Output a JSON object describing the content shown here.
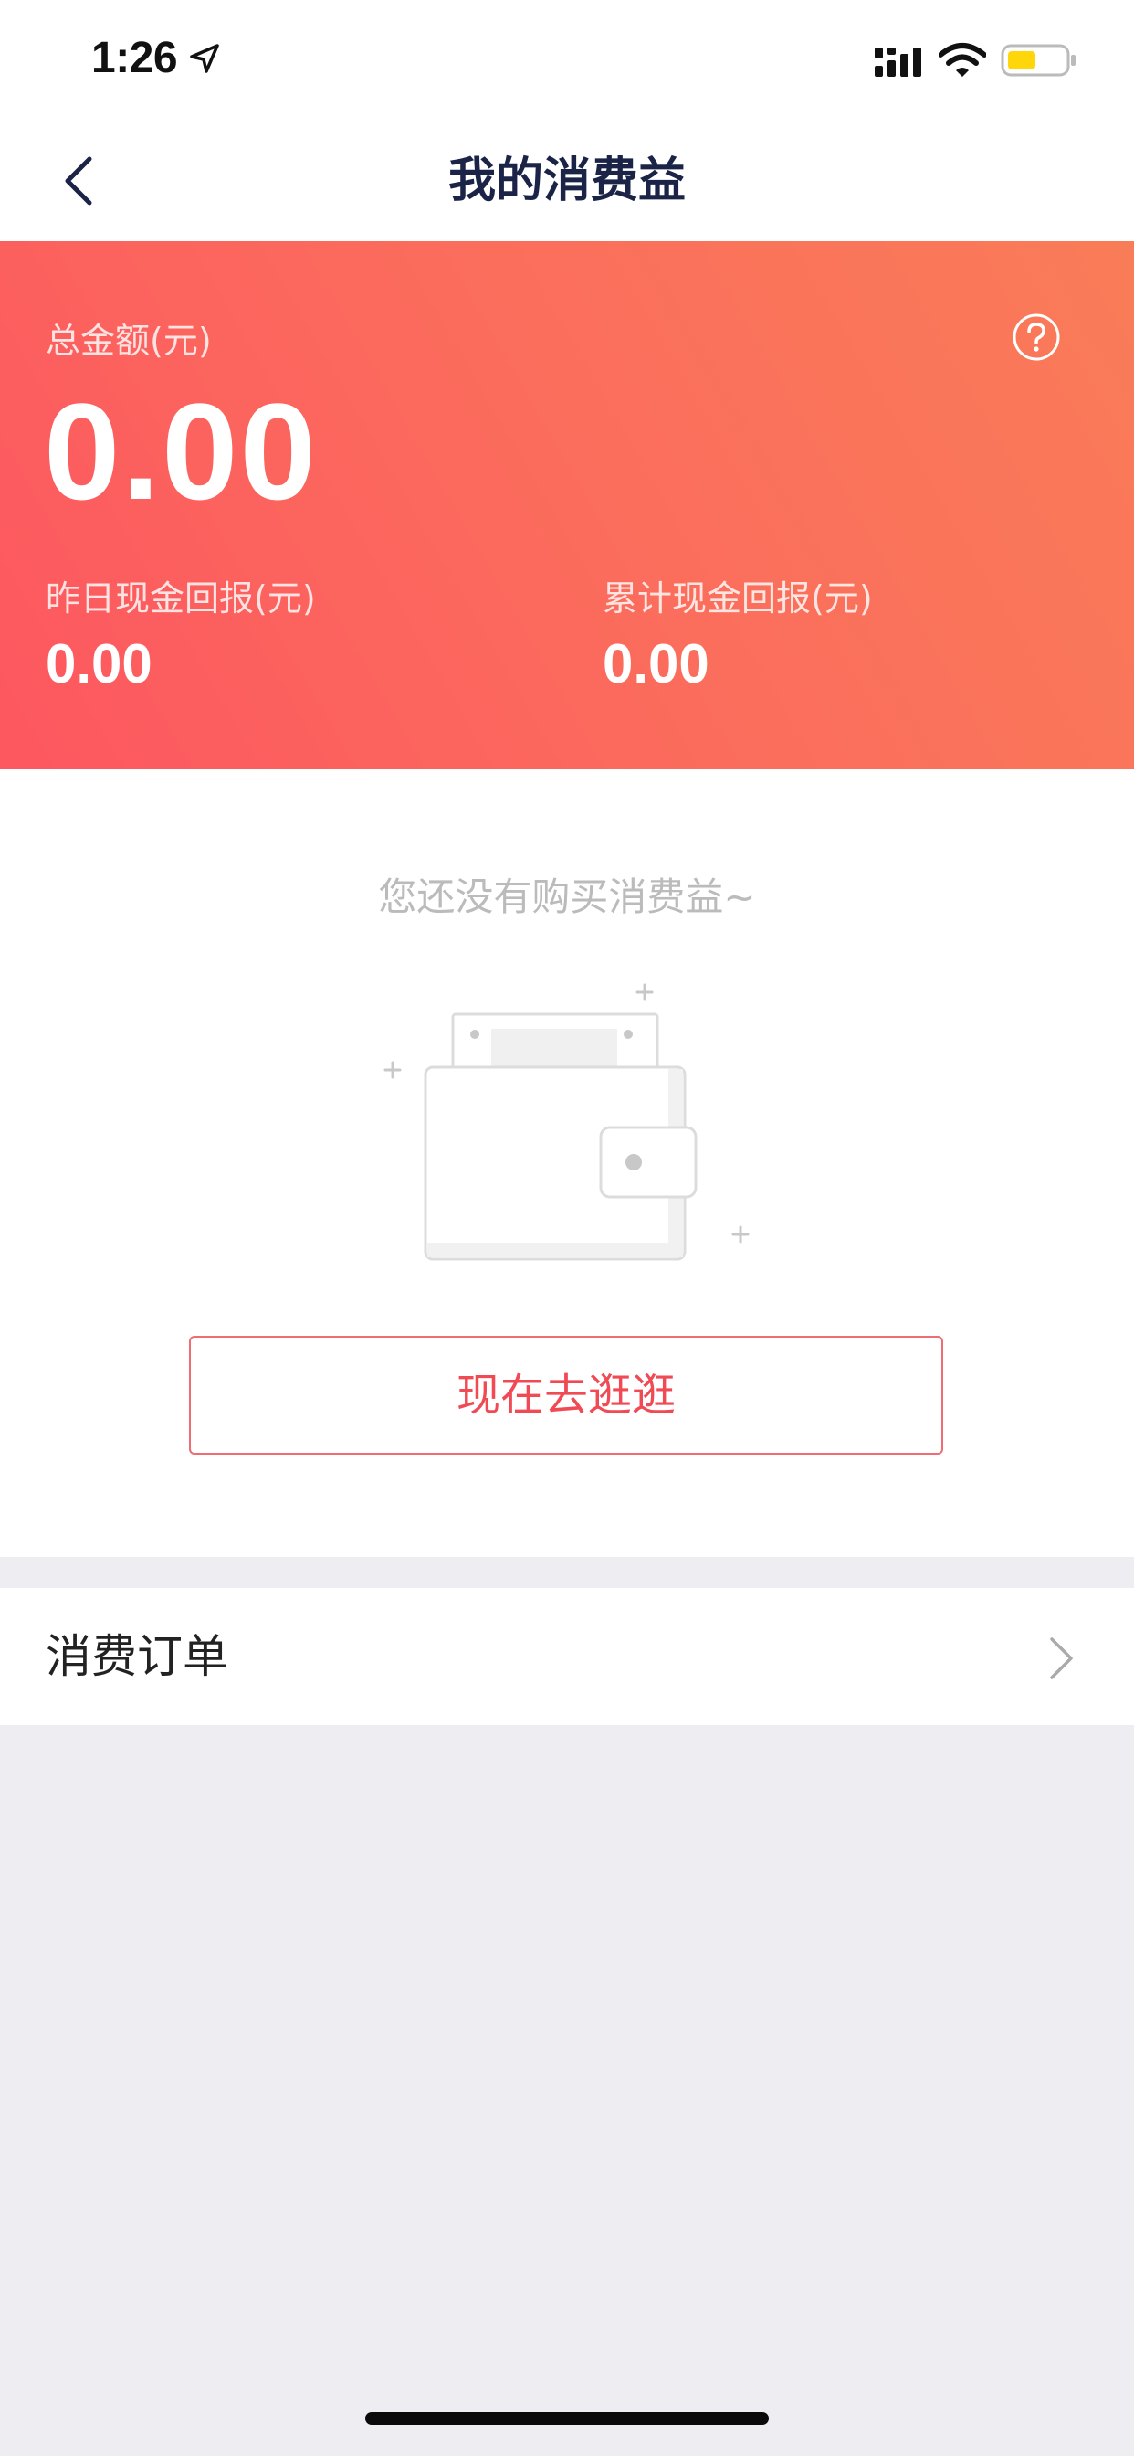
{
  "status_bar": {
    "time": "1:26",
    "icons": [
      "location-arrow-icon",
      "cellular-signal-icon",
      "wifi-icon",
      "battery-icon"
    ],
    "battery_color": "#FFD60A"
  },
  "nav": {
    "title": "我的消费益",
    "back_icon": "chevron-left-icon"
  },
  "summary": {
    "total_label": "总金额(元)",
    "total_value": "0.00",
    "help_icon": "question-circle-icon",
    "yesterday_label": "昨日现金回报(元)",
    "yesterday_value": "0.00",
    "cumulative_label": "累计现金回报(元)",
    "cumulative_value": "0.00",
    "gradient_start": "#FD5760",
    "gradient_end": "#F97C58"
  },
  "empty_state": {
    "message": "您还没有购买消费益~",
    "illustration": "empty-wallet-illustration",
    "button_label": "现在去逛逛",
    "button_color": "#F04A55"
  },
  "orders": {
    "label": "消费订单",
    "chevron_icon": "chevron-right-icon"
  }
}
